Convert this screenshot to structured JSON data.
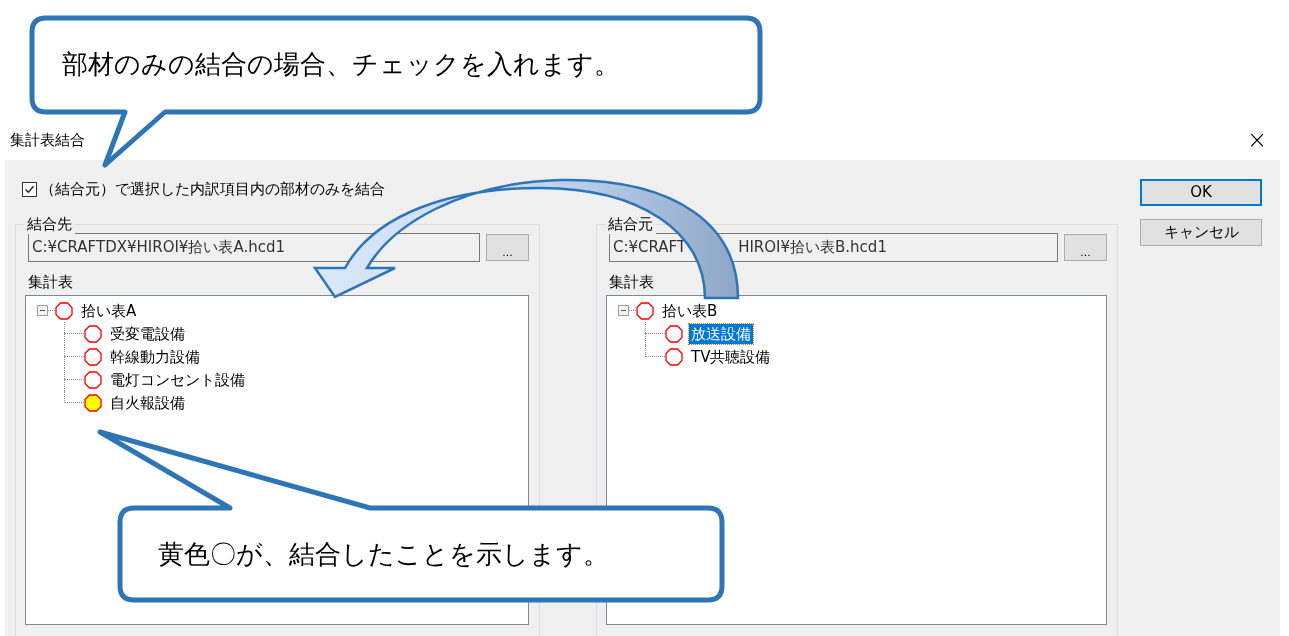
{
  "callouts": [
    {
      "text": "部材のみの結合の場合、チェックを入れます。"
    },
    {
      "text": "黄色〇が、結合したことを示します。"
    }
  ],
  "window": {
    "title": "集計表結合",
    "close": "×"
  },
  "option": {
    "label": "（結合元）で選択した内訳項目内の部材のみを結合",
    "checked": true
  },
  "panes": [
    {
      "group_label": "結合先",
      "path_parts": [
        "C:¥CRAFTDX¥HIROI¥拾い表A.hcd1"
      ],
      "browse_label": "...",
      "tree_label": "集計表",
      "tree": [
        {
          "label": "拾い表A",
          "expanded": true,
          "merged": false,
          "selected": false,
          "children": [
            {
              "label": "受変電設備",
              "merged": false,
              "selected": false
            },
            {
              "label": "幹線動力設備",
              "merged": false,
              "selected": false
            },
            {
              "label": "電灯コンセント設備",
              "merged": false,
              "selected": false
            },
            {
              "label": "自火報設備",
              "merged": true,
              "selected": false
            }
          ]
        }
      ]
    },
    {
      "group_label": "結合元",
      "path_parts": [
        "C:¥CRAFT",
        "HIROI¥拾い表B.hcd1"
      ],
      "browse_label": "...",
      "tree_label": "集計表",
      "tree": [
        {
          "label": "拾い表B",
          "expanded": true,
          "merged": false,
          "selected": false,
          "children": [
            {
              "label": "放送設備",
              "merged": false,
              "selected": true
            },
            {
              "label": "TV共聴設備",
              "merged": false,
              "selected": false
            }
          ]
        }
      ]
    }
  ],
  "buttons": [
    {
      "label": "OK",
      "default": true
    },
    {
      "label": "キャンセル",
      "default": false
    }
  ]
}
